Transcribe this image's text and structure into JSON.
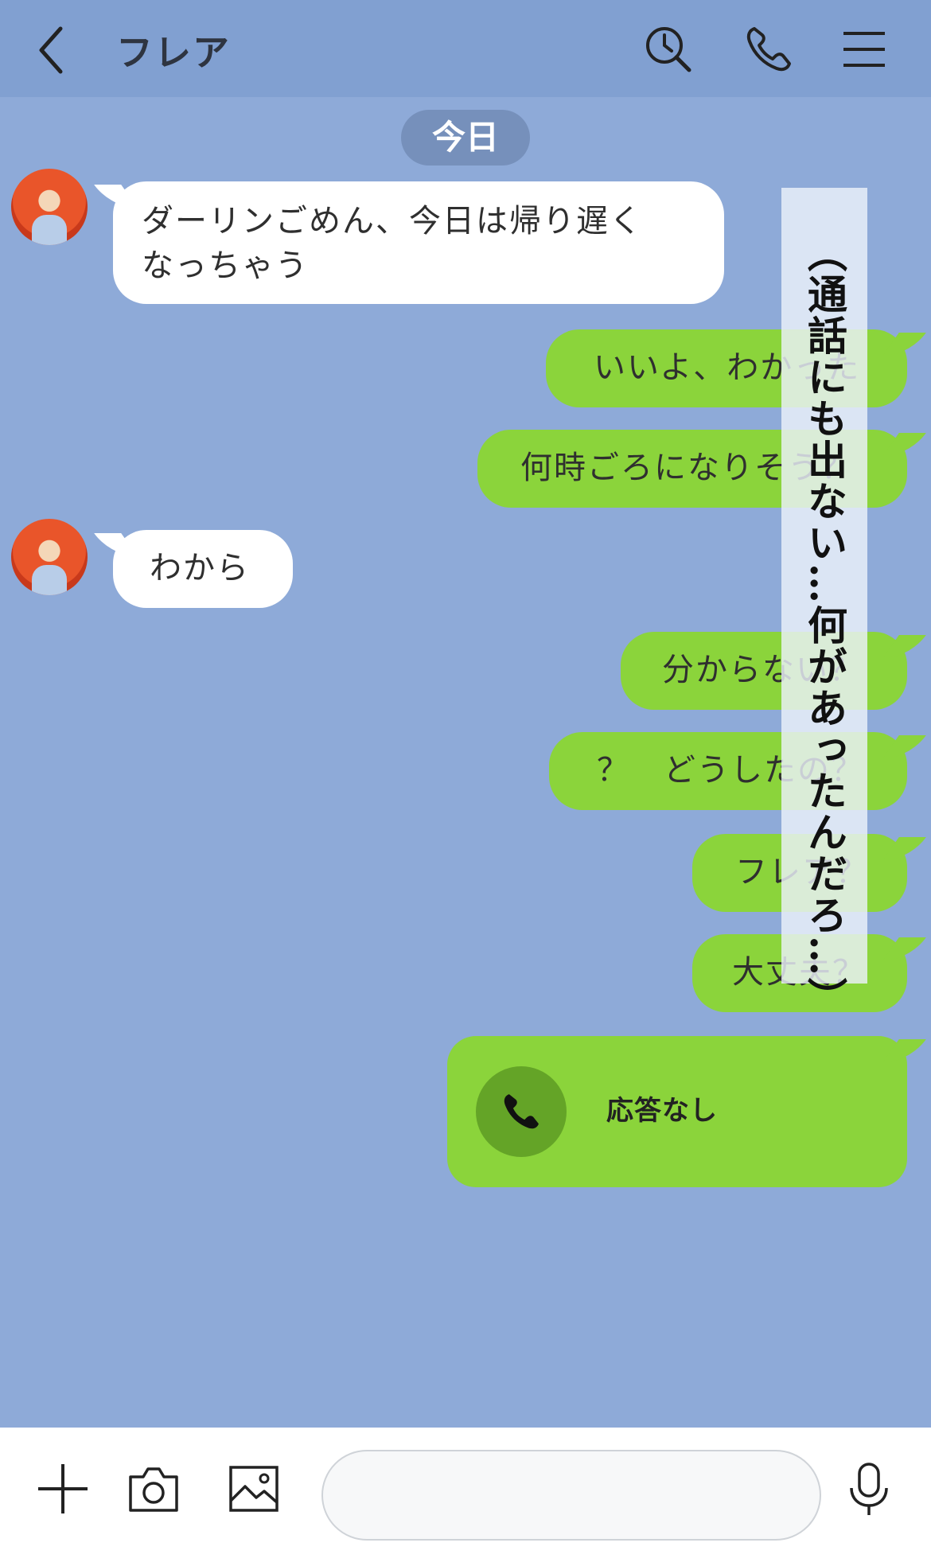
{
  "header": {
    "title": "フレア",
    "back_icon": "chevron-left-icon",
    "icons": [
      "search-icon",
      "phone-icon",
      "menu-icon"
    ]
  },
  "date_label": "今日",
  "messages": [
    {
      "side": "left",
      "text_line1": "ダーリンごめん、今日は帰り遅く",
      "text_line2": "なっちゃう"
    },
    {
      "side": "right",
      "text": "いいよ、わかった"
    },
    {
      "side": "right",
      "text": "何時ごろになりそう？"
    },
    {
      "side": "left",
      "text": "わから"
    },
    {
      "side": "right",
      "text": "分からない？"
    },
    {
      "side": "right",
      "text": "？　どうしたの？"
    },
    {
      "side": "right",
      "text": "フレア？"
    },
    {
      "side": "right",
      "text": "大丈夫？"
    }
  ],
  "call": {
    "label": "応答なし",
    "icon": "phone-icon"
  },
  "overlay_caption": "（通話にも出ない…何があったんだろ…）",
  "footer": {
    "icons": [
      "plus-icon",
      "camera-icon",
      "image-icon",
      "microphone-icon"
    ],
    "input_placeholder": ""
  },
  "colors": {
    "background": "#8eaad8",
    "header": "#81a0d1",
    "sent_bubble": "#8bd43b",
    "received_bubble": "#ffffff"
  }
}
